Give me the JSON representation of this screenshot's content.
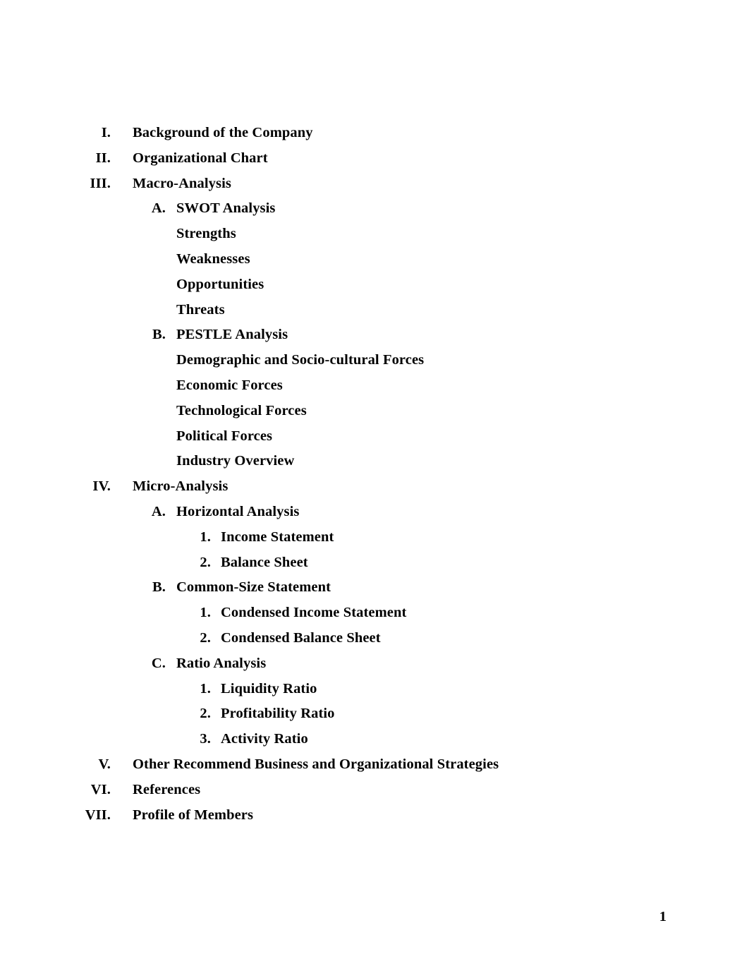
{
  "document": {
    "page_number": "1",
    "text_color": "#000000",
    "background_color": "#ffffff"
  },
  "outline": {
    "items": [
      {
        "level": 1,
        "marker": "I.",
        "text": "Background of the Company"
      },
      {
        "level": 1,
        "marker": "II.",
        "text": "Organizational Chart"
      },
      {
        "level": 1,
        "marker": "III.",
        "text": "Macro-Analysis"
      },
      {
        "level": 2,
        "marker": "A.",
        "text": "SWOT Analysis"
      },
      {
        "level": 2,
        "marker": "",
        "text": "Strengths"
      },
      {
        "level": 2,
        "marker": "",
        "text": "Weaknesses"
      },
      {
        "level": 2,
        "marker": "",
        "text": "Opportunities"
      },
      {
        "level": 2,
        "marker": "",
        "text": "Threats"
      },
      {
        "level": 2,
        "marker": "B.",
        "text": "PESTLE Analysis"
      },
      {
        "level": 2,
        "marker": "",
        "text": "Demographic and Socio-cultural Forces"
      },
      {
        "level": 2,
        "marker": "",
        "text": "Economic Forces"
      },
      {
        "level": 2,
        "marker": "",
        "text": "Technological Forces"
      },
      {
        "level": 2,
        "marker": "",
        "text": "Political Forces"
      },
      {
        "level": 2,
        "marker": "",
        "text": "Industry Overview"
      },
      {
        "level": 1,
        "marker": "IV.",
        "text": "Micro-Analysis"
      },
      {
        "level": 2,
        "marker": "A.",
        "text": "Horizontal Analysis"
      },
      {
        "level": 3,
        "marker": "1.",
        "text": "Income Statement"
      },
      {
        "level": 3,
        "marker": "2.",
        "text": "Balance Sheet"
      },
      {
        "level": 2,
        "marker": "B.",
        "text": "Common-Size Statement"
      },
      {
        "level": 3,
        "marker": "1.",
        "text": "Condensed Income Statement"
      },
      {
        "level": 3,
        "marker": "2.",
        "text": "Condensed Balance Sheet"
      },
      {
        "level": 2,
        "marker": "C.",
        "text": "Ratio Analysis"
      },
      {
        "level": 3,
        "marker": "1.",
        "text": "Liquidity Ratio"
      },
      {
        "level": 3,
        "marker": "2.",
        "text": "Profitability Ratio"
      },
      {
        "level": 3,
        "marker": "3.",
        "text": "Activity Ratio"
      },
      {
        "level": 1,
        "marker": "V.",
        "text": "Other Recommend Business and Organizational Strategies"
      },
      {
        "level": 1,
        "marker": "VI.",
        "text": "References"
      },
      {
        "level": 1,
        "marker": "VII.",
        "text": "Profile of Members"
      }
    ]
  }
}
